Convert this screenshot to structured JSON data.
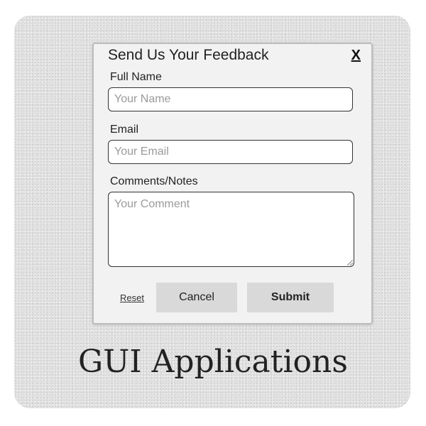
{
  "dialog": {
    "title": "Send Us Your Feedback",
    "close_label": "X"
  },
  "form": {
    "name": {
      "label": "Full Name",
      "placeholder": "Your Name",
      "value": ""
    },
    "email": {
      "label": "Email",
      "placeholder": "Your Email",
      "value": ""
    },
    "comments": {
      "label": "Comments/Notes",
      "placeholder": "Your Comment",
      "value": ""
    }
  },
  "actions": {
    "reset_label": "Reset",
    "cancel_label": "Cancel",
    "submit_label": "Submit"
  },
  "caption": "GUI Applications",
  "colors": {
    "button_bg": "#d9d9d9",
    "dialog_bg": "#f2f2f2",
    "card_bg": "#e2e2e2"
  }
}
